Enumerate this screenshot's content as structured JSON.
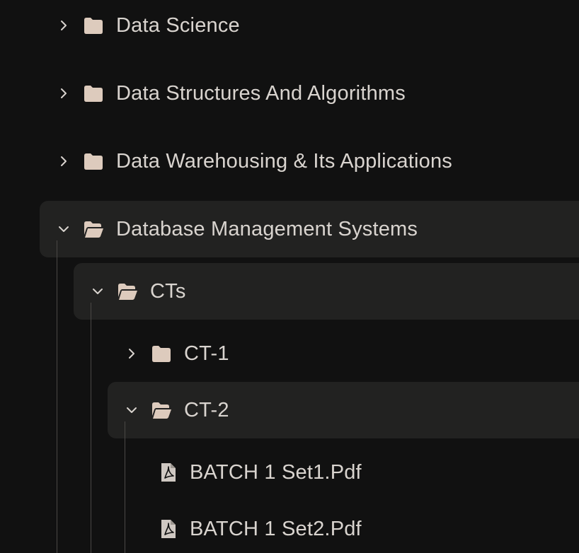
{
  "tree": {
    "items": [
      {
        "label": "Data Science",
        "state": "collapsed",
        "icon": "folder-closed-icon"
      },
      {
        "label": "Data Structures And Algorithms",
        "state": "collapsed",
        "icon": "folder-closed-icon"
      },
      {
        "label": "Data Warehousing & Its Applications",
        "state": "collapsed",
        "icon": "folder-closed-icon"
      },
      {
        "label": "Database Management Systems",
        "state": "expanded",
        "icon": "folder-open-icon",
        "children": [
          {
            "label": "CTs",
            "state": "expanded",
            "icon": "folder-open-icon",
            "children": [
              {
                "label": "CT-1",
                "state": "collapsed",
                "icon": "folder-closed-icon"
              },
              {
                "label": "CT-2",
                "state": "expanded",
                "icon": "folder-open-icon",
                "children": [
                  {
                    "label": "BATCH 1 Set1.Pdf",
                    "icon": "pdf-file-icon"
                  },
                  {
                    "label": "BATCH 1 Set2.Pdf",
                    "icon": "pdf-file-icon"
                  }
                ]
              }
            ]
          }
        ]
      }
    ]
  },
  "colors": {
    "background": "#111111",
    "selected_row": "#222221",
    "text": "#d9d4cf",
    "icon": "#ddcbbd",
    "guide_line": "#4a4846"
  }
}
